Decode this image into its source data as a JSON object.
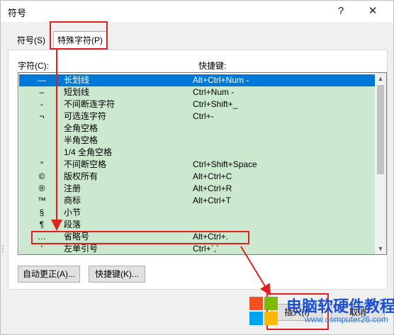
{
  "window": {
    "title": "符号",
    "help": "?",
    "close": "✕"
  },
  "tabs": [
    {
      "label": "符号(S)"
    },
    {
      "label": "特殊字符(P)"
    }
  ],
  "headers": {
    "char": "字符(C):",
    "shortcut": "快捷键:"
  },
  "rows": [
    {
      "sym": "—",
      "name": "长划线",
      "key": "Alt+Ctrl+Num -"
    },
    {
      "sym": "–",
      "name": "短划线",
      "key": "Ctrl+Num -"
    },
    {
      "sym": "-",
      "name": "不间断连字符",
      "key": "Ctrl+Shift+_"
    },
    {
      "sym": "¬",
      "name": "可选连字符",
      "key": "Ctrl+-"
    },
    {
      "sym": "",
      "name": "全角空格",
      "key": ""
    },
    {
      "sym": "",
      "name": "半角空格",
      "key": ""
    },
    {
      "sym": "",
      "name": "1/4 全角空格",
      "key": ""
    },
    {
      "sym": "°",
      "name": "不间断空格",
      "key": "Ctrl+Shift+Space"
    },
    {
      "sym": "©",
      "name": "版权所有",
      "key": "Alt+Ctrl+C"
    },
    {
      "sym": "®",
      "name": "注册",
      "key": "Alt+Ctrl+R"
    },
    {
      "sym": "™",
      "name": "商标",
      "key": "Alt+Ctrl+T"
    },
    {
      "sym": "§",
      "name": "小节",
      "key": ""
    },
    {
      "sym": "¶",
      "name": "段落",
      "key": ""
    },
    {
      "sym": "…",
      "name": "省略号",
      "key": "Alt+Ctrl+."
    },
    {
      "sym": "'",
      "name": "左单引号",
      "key": "Ctrl+`,`"
    }
  ],
  "buttons": {
    "autocorrect": "自动更正(A)...",
    "shortcut": "快捷键(K)...",
    "insert": "插入(I)",
    "cancel": "取消"
  },
  "watermark": {
    "line1": "电脑软硬件教程网",
    "line2": "www.computer26.com"
  },
  "colors": {
    "row_bg": "#cce8cf",
    "selected_bg": "#0078d7",
    "annotation": "#e02020"
  }
}
